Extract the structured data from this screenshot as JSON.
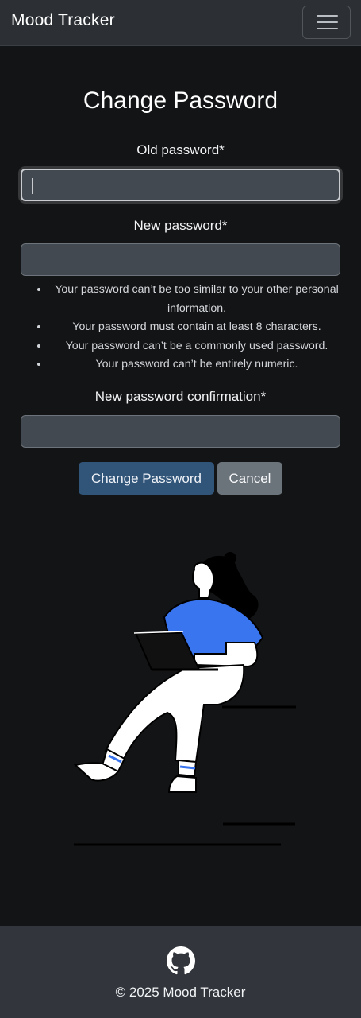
{
  "navbar": {
    "brand": "Mood Tracker",
    "menu_icon": "hamburger-icon"
  },
  "form": {
    "title": "Change Password",
    "old_password_label": "Old password*",
    "new_password_label": "New password*",
    "confirm_label": "New password confirmation*",
    "old_password_value": "",
    "new_password_value": "",
    "confirm_value": "",
    "help_items": [
      "Your password can’t be too similar to your other personal information.",
      "Your password must contain at least 8 characters.",
      "Your password can’t be a commonly used password.",
      "Your password can’t be entirely numeric."
    ],
    "submit_label": "Change Password",
    "cancel_label": "Cancel"
  },
  "illustration": {
    "icon": "person-with-laptop-illustration",
    "shirt_color": "#3a75f0"
  },
  "footer": {
    "icon": "github-icon",
    "copyright": "© 2025 Mood Tracker"
  },
  "colors": {
    "background": "#131415",
    "navbar": "#2c3034",
    "footer": "#32363c",
    "primary_button": "#315479",
    "secondary_button": "#6b737b",
    "input_background": "#434950"
  }
}
